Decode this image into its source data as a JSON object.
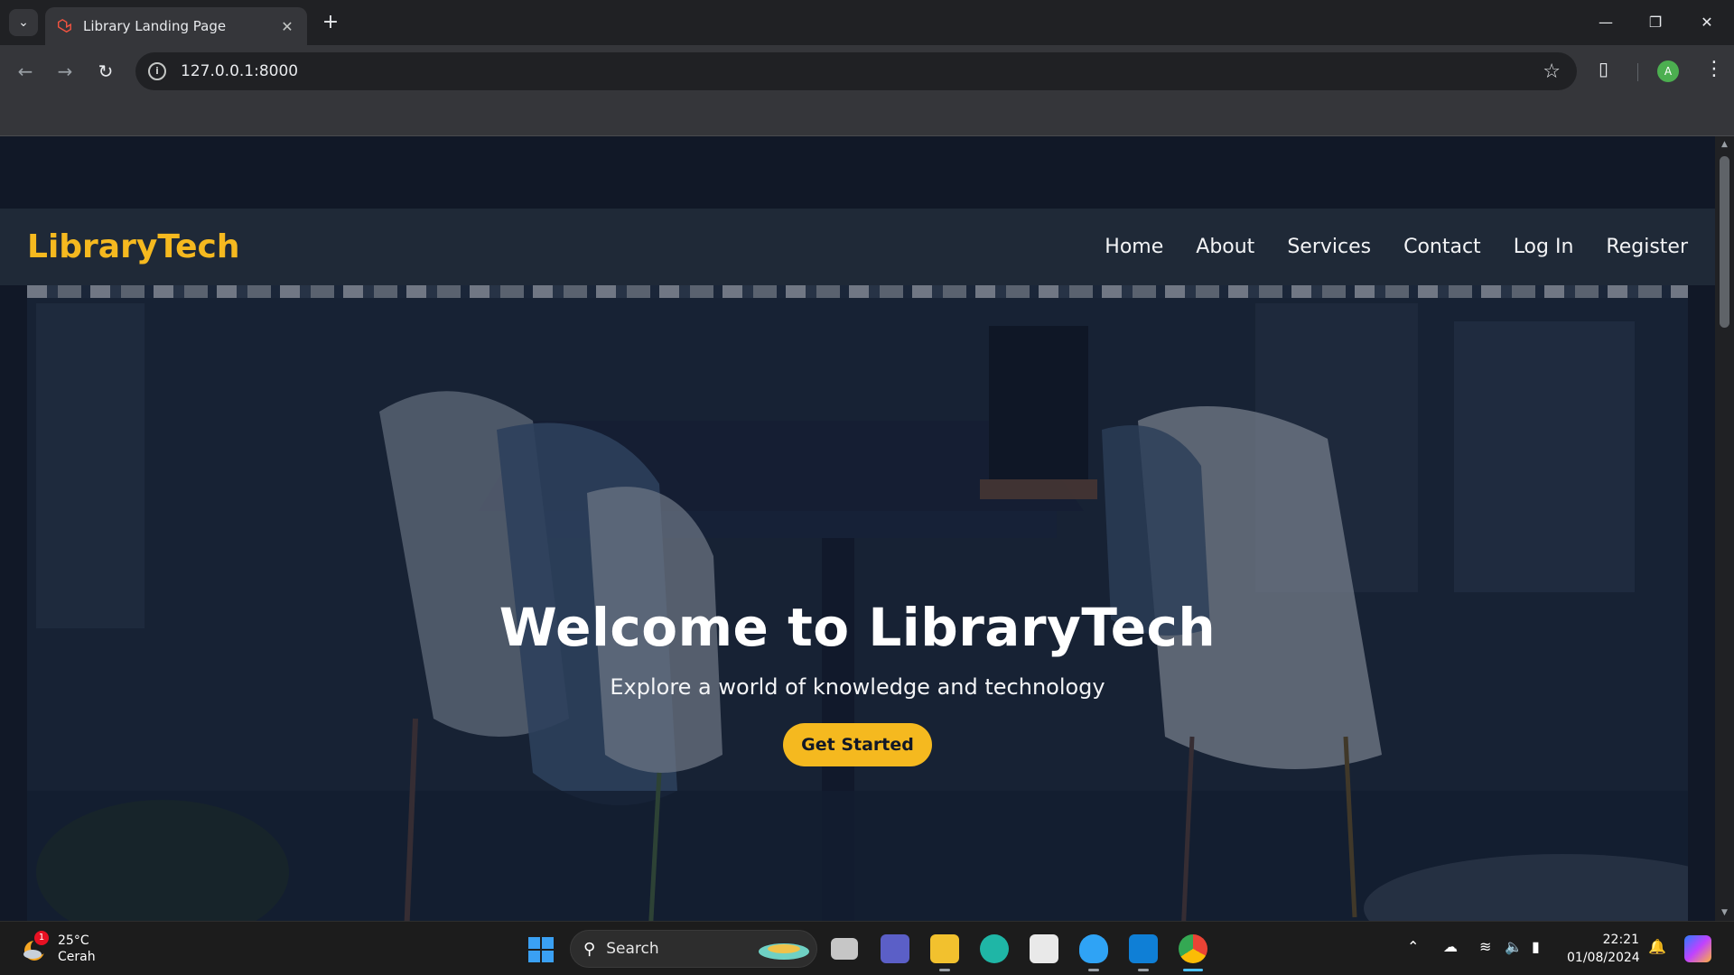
{
  "browser": {
    "tab_title": "Library Landing Page",
    "url": "127.0.0.1:8000",
    "new_tab_label": "+",
    "profile_initial": "A"
  },
  "page": {
    "brand": "LibraryTech",
    "nav": [
      {
        "label": "Home"
      },
      {
        "label": "About"
      },
      {
        "label": "Services"
      },
      {
        "label": "Contact"
      },
      {
        "label": "Log In"
      },
      {
        "label": "Register"
      }
    ],
    "hero": {
      "title": "Welcome to LibraryTech",
      "subtitle": "Explore a world of knowledge and technology",
      "cta_label": "Get Started"
    },
    "colors": {
      "brand": "#f5b91f",
      "navbar": "#1f2937",
      "page_bg": "#111827"
    }
  },
  "taskbar": {
    "weather_temp": "25°C",
    "weather_desc": "Cerah",
    "weather_badge": "1",
    "search_label": "Search",
    "time": "22:21",
    "date": "01/08/2024"
  }
}
